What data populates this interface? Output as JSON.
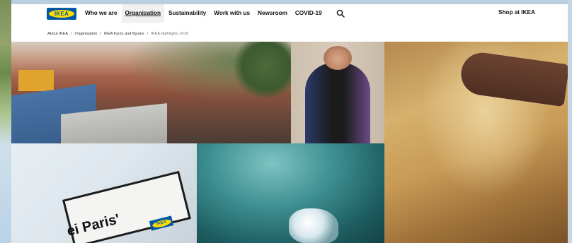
{
  "header": {
    "logo_text": "IKEA",
    "nav": [
      {
        "label": "Who we are",
        "active": false
      },
      {
        "label": "Organisation",
        "active": true
      },
      {
        "label": "Sustainability",
        "active": false
      },
      {
        "label": "Work with us",
        "active": false
      },
      {
        "label": "Newsroom",
        "active": false
      },
      {
        "label": "COVID-19",
        "active": false
      }
    ],
    "search_icon": "search-icon",
    "shop_label": "Shop at IKEA"
  },
  "breadcrumb": [
    "About IKEA",
    "Organisation",
    "IKEA Facts and figures",
    "IKEA Highlights 2019"
  ],
  "breadcrumb_separator": "/",
  "photos": {
    "sign_text": "ei Paris'",
    "sign_logo": "IKEA"
  },
  "colors": {
    "brand_blue": "#0058a3",
    "brand_yellow": "#ffdb00"
  }
}
